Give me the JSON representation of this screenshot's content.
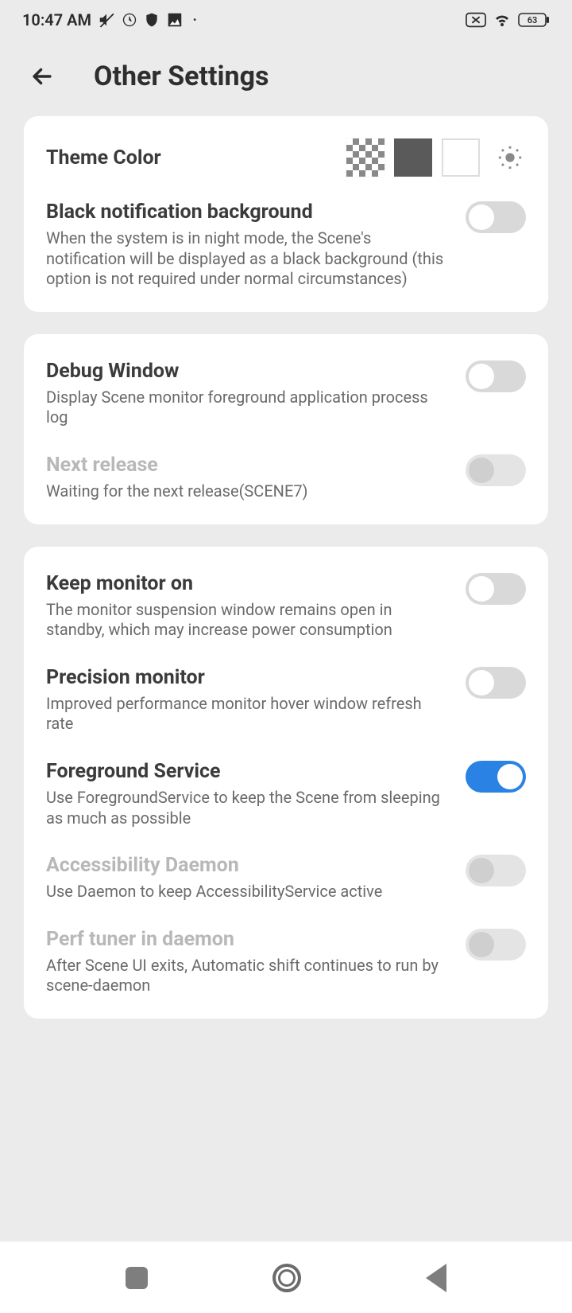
{
  "statusBar": {
    "time": "10:47 AM",
    "battery": "63"
  },
  "header": {
    "title": "Other Settings"
  },
  "cards": {
    "theme": {
      "label": "Theme Color"
    },
    "blackNotif": {
      "title": "Black notification background",
      "desc": "When the system is in night mode, the Scene's notification will be displayed as a black background (this option is not required under normal circumstances)"
    },
    "debug": {
      "title": "Debug Window",
      "desc": "Display Scene monitor foreground application process log"
    },
    "nextRelease": {
      "title": "Next release",
      "desc": "Waiting for the next release(SCENE7)"
    },
    "keepMonitor": {
      "title": "Keep monitor on",
      "desc": "The monitor suspension window remains open in standby, which may increase power consumption"
    },
    "precision": {
      "title": "Precision monitor",
      "desc": "Improved performance monitor hover window refresh rate"
    },
    "foreground": {
      "title": "Foreground Service",
      "desc": "Use ForegroundService to keep the Scene from sleeping as much as possible"
    },
    "accessibility": {
      "title": "Accessibility Daemon",
      "desc": "Use Daemon to keep AccessibilityService active"
    },
    "perfTuner": {
      "title": "Perf tuner in daemon",
      "desc": "After Scene UI exits, Automatic shift continues to run by scene-daemon"
    }
  }
}
